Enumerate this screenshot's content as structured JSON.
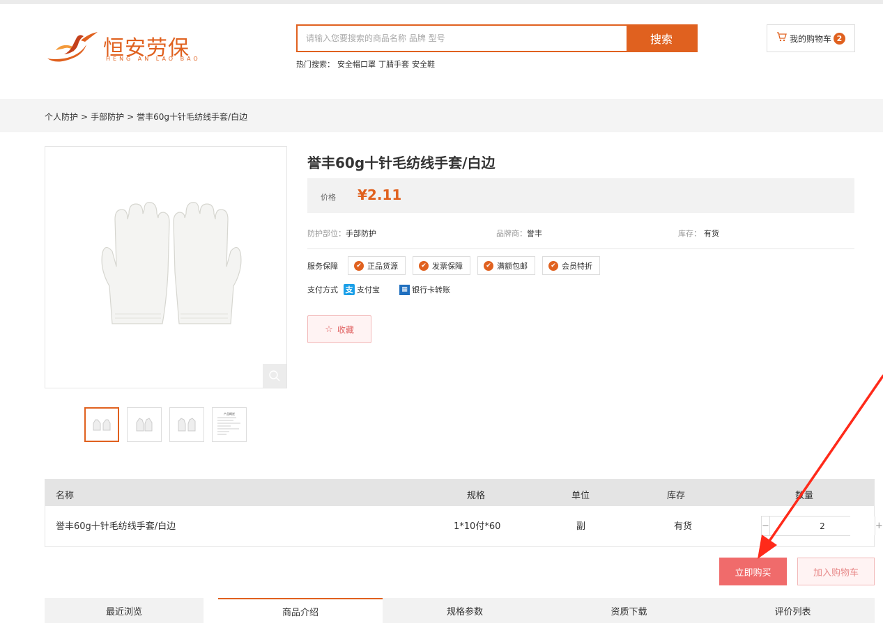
{
  "brand": {
    "name_cn": "恒安劳保",
    "name_en": "HENG AN LAO BAO",
    "color": "#e0611f"
  },
  "search": {
    "placeholder": "请输入您要搜索的商品名称 品牌 型号",
    "button": "搜索",
    "hot_label": "热门搜索：",
    "hot_terms": [
      "安全帽",
      "口罩",
      "丁腈手套",
      "安全鞋"
    ]
  },
  "cart": {
    "label": "我的购物车",
    "count": "2",
    "icon": "cart-icon"
  },
  "breadcrumb": {
    "items": [
      "个人防护",
      "手部防护",
      "誉丰60g十针毛纺线手套/白边"
    ],
    "separator": ">"
  },
  "product": {
    "title": "誉丰60g十针毛纺线手套/白边",
    "price_label": "价格",
    "price": "¥2.11",
    "attrs": [
      {
        "label": "防护部位：",
        "value": "手部防护"
      },
      {
        "label": "品牌商：",
        "value": "誉丰"
      },
      {
        "label": "库存：",
        "value": "有货"
      }
    ],
    "service_label": "服务保障",
    "services": [
      "正品货源",
      "发票保障",
      "满额包邮",
      "会员特折"
    ],
    "pay_label": "支付方式",
    "pay_methods": [
      "支付宝",
      "银行卡转账"
    ],
    "favorite": "收藏",
    "thumbs_count": 4,
    "thumb_doc_title": "产品概述"
  },
  "spec_table": {
    "headers": [
      "名称",
      "规格",
      "单位",
      "库存",
      "数量"
    ],
    "row": {
      "name": "誉丰60g十针毛纺线手套/白边",
      "spec": "1*10付*60",
      "unit": "副",
      "stock": "有货",
      "qty": "2"
    },
    "minus": "−",
    "plus": "+"
  },
  "actions": {
    "buy_now": "立即购买",
    "add_to_cart": "加入购物车"
  },
  "tabs": [
    {
      "label": "最近浏览",
      "active": false
    },
    {
      "label": "商品介绍",
      "active": true
    },
    {
      "label": "规格参数",
      "active": false
    },
    {
      "label": "资质下载",
      "active": false
    },
    {
      "label": "评价列表",
      "active": false
    }
  ],
  "colors": {
    "accent": "#e0611f",
    "buy": "#f06b6b",
    "annotation": "#ff2a1a"
  }
}
